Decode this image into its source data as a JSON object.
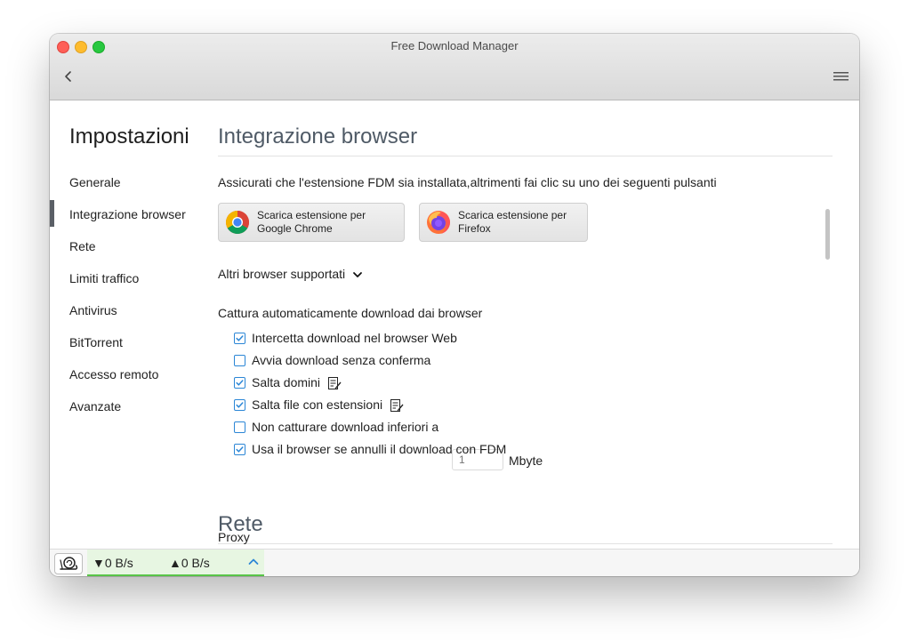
{
  "window": {
    "title": "Free Download Manager"
  },
  "sidebar": {
    "title": "Impostazioni",
    "items": [
      {
        "label": "Generale"
      },
      {
        "label": "Integrazione browser",
        "active": true
      },
      {
        "label": "Rete"
      },
      {
        "label": "Limiti traffico"
      },
      {
        "label": "Antivirus"
      },
      {
        "label": "BitTorrent"
      },
      {
        "label": "Accesso remoto"
      },
      {
        "label": "Avanzate"
      }
    ]
  },
  "browser_section": {
    "title": "Integrazione browser",
    "intro": "Assicurati che l'estensione FDM sia installata,altrimenti fai clic su uno dei seguenti pulsanti",
    "chrome_button": {
      "line1": "Scarica estensione per",
      "line2": "Google Chrome",
      "icon": "chrome-icon"
    },
    "firefox_button": {
      "line1": "Scarica estensione per",
      "line2": "Firefox",
      "icon": "firefox-icon"
    },
    "other_browsers": "Altri browser supportati",
    "capture_heading": "Cattura automaticamente download dai browser",
    "options": [
      {
        "label": "Intercetta download nel browser Web",
        "checked": true
      },
      {
        "label": "Avvia download senza conferma",
        "checked": false
      },
      {
        "label": "Salta domini",
        "checked": true,
        "edit_icon": true
      },
      {
        "label": "Salta file con estensioni",
        "checked": true,
        "edit_icon": true
      },
      {
        "label": "Non catturare download inferiori a",
        "checked": false
      },
      {
        "label": "Usa il browser se annulli il download con FDM",
        "checked": true
      }
    ],
    "min_size_placeholder": "1",
    "min_size_unit": "Mbyte"
  },
  "network_section": {
    "title": "Rete",
    "proxy_label": "Proxy"
  },
  "statusbar": {
    "download_speed": "▼0 B/s",
    "upload_speed": "▲0 B/s"
  },
  "colors": {
    "accent": "#2b86d6",
    "speed_panel_bg": "#e7f6e2",
    "speed_panel_border": "#58c447",
    "section_title": "#4f5a66"
  }
}
